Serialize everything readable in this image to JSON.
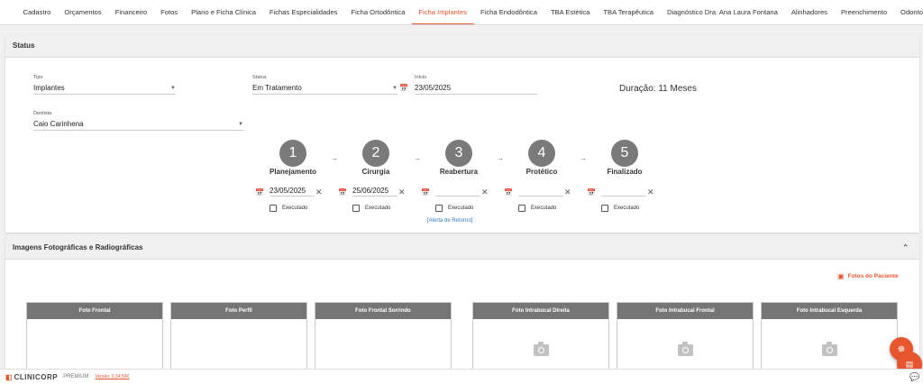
{
  "tabs": [
    {
      "label": "Cadastro",
      "active": false
    },
    {
      "label": "Orçamentos",
      "active": false
    },
    {
      "label": "Financeiro",
      "active": false
    },
    {
      "label": "Fotos",
      "active": false
    },
    {
      "label": "Plano e Ficha Clínica",
      "active": false
    },
    {
      "label": "Fichas Especialidades",
      "active": false
    },
    {
      "label": "Ficha Ortodôntica",
      "active": false
    },
    {
      "label": "Ficha Implantes",
      "active": true
    },
    {
      "label": "Ficha Endodôntica",
      "active": false
    },
    {
      "label": "TBA Estética",
      "active": false
    },
    {
      "label": "TBA Terapêutica",
      "active": false
    },
    {
      "label": "Diagnóstico Dra. Ana Laura Fontana",
      "active": false
    },
    {
      "label": "Alinhadores",
      "active": false
    },
    {
      "label": "Preenchimento",
      "active": false
    },
    {
      "label": "Odontogra",
      "active": false
    }
  ],
  "status_panel": {
    "title": "Status",
    "tipo": {
      "label": "Tipo",
      "value": "Implantes"
    },
    "status": {
      "label": "Status",
      "value": "Em Tratamento"
    },
    "inicio": {
      "label": "Início",
      "value": "23/05/2025"
    },
    "duracao": "Duração: 11 Meses",
    "dentista": {
      "label": "Dentista",
      "value": "Caio Carinhena"
    },
    "steps": [
      {
        "number": "1",
        "title": "Planejamento",
        "date": "23/05/2025",
        "executed_label": "Executado",
        "executed": false,
        "alert": ""
      },
      {
        "number": "2",
        "title": "Cirurgia",
        "date": "25/06/2025",
        "executed_label": "Executado",
        "executed": false,
        "alert": ""
      },
      {
        "number": "3",
        "title": "Reabertura",
        "date": "",
        "executed_label": "Executado",
        "executed": false,
        "alert": "[Alerta de Retorno]"
      },
      {
        "number": "4",
        "title": "Protético",
        "date": "",
        "executed_label": "Executado",
        "executed": false,
        "alert": ""
      },
      {
        "number": "5",
        "title": "Finalizado",
        "date": "",
        "executed_label": "Executado",
        "executed": false,
        "alert": ""
      }
    ]
  },
  "images_panel": {
    "title": "Imagens Fotográficas e Radiográficas",
    "fotos_link": "Fotos do Paciente",
    "photos": [
      {
        "label": "Foto Frontal",
        "has_camera": false
      },
      {
        "label": "Foto Perfil",
        "has_camera": false
      },
      {
        "label": "Foto Frontal Sorrindo",
        "has_camera": false
      },
      {
        "label": "Foto Intrabucal Direita",
        "has_camera": true
      },
      {
        "label": "Foto Intrabucal Frontal",
        "has_camera": true
      },
      {
        "label": "Foto Intrabucal Esquerda",
        "has_camera": true
      }
    ]
  },
  "footer": {
    "logo_mark": "◧",
    "brand": "CLINICORP",
    "plan": "PREMIUM",
    "version": "Versão: 0.34.506"
  },
  "icons": {
    "calendar": "calendar-icon",
    "close": "close-icon",
    "arrow": "arrow-right-icon",
    "camera": "camera-icon",
    "chevron_up": "chevron-up-icon",
    "chat": "chat-icon",
    "fab_tools": "tools-icon",
    "fab_save": "save-icon"
  },
  "colors": {
    "accent": "#e8562f",
    "step_circle": "#7a7a7a",
    "photo_header": "#757575",
    "link": "#2f7ec6"
  }
}
